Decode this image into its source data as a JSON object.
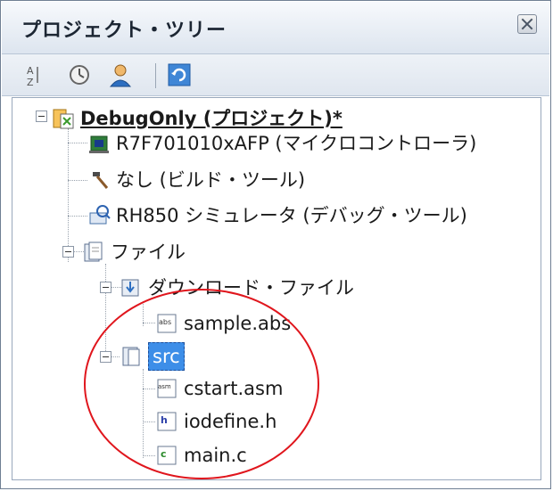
{
  "panel": {
    "title": "プロジェクト・ツリー"
  },
  "toolbar": {
    "icons": [
      "sort-icon",
      "properties-icon",
      "user-icon",
      "refresh-icon"
    ]
  },
  "tree": {
    "project": "DebugOnly (プロジェクト)*",
    "microcontroller": "R7F701010xAFP (マイクロコントローラ)",
    "build_tool": "なし (ビルド・ツール)",
    "debug_tool": "RH850 シミュレータ (デバッグ・ツール)",
    "files": "ファイル",
    "download_files": "ダウンロード・ファイル",
    "sample_abs": "sample.abs",
    "src": "src",
    "cstart": "cstart.asm",
    "iodefine": "iodefine.h",
    "main": "main.c"
  },
  "colors": {
    "selection": "#3d8ee8",
    "highlight_ellipse": "#e0161d"
  }
}
